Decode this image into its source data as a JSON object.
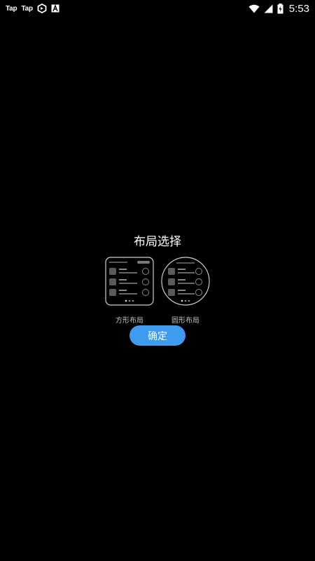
{
  "status_bar": {
    "left_labels": [
      "Tap",
      "Tap"
    ],
    "icons_left": [
      "taptap-icon",
      "taptap-icon",
      "sync-icon",
      "a-notification-icon"
    ],
    "icons_right": [
      "wifi-icon",
      "cellular-signal-icon",
      "battery-charging-icon"
    ],
    "time": "5:53"
  },
  "dialog": {
    "title": "布局选择",
    "options": [
      {
        "label": "方形布局",
        "icon": "square-layout-preview"
      },
      {
        "label": "圆形布局",
        "icon": "round-layout-preview"
      }
    ],
    "confirm_label": "确定",
    "accent_color": "#3e9bf0"
  }
}
